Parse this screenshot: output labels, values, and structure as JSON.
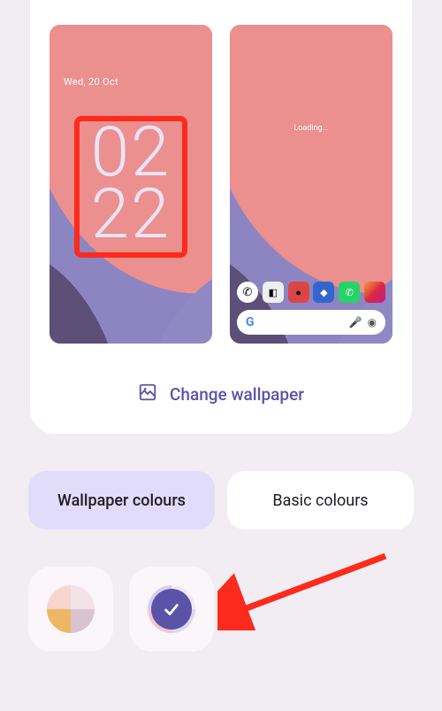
{
  "lockscreen": {
    "date": "Wed, 20 Oct",
    "clock_top": "02",
    "clock_bottom": "22"
  },
  "homescreen": {
    "loading": "Loading...",
    "search_letter": "G"
  },
  "change_wallpaper_label": "Change wallpaper",
  "tabs": {
    "wallpaper": "Wallpaper colours",
    "basic": "Basic colours"
  },
  "palettes": [
    {
      "q": [
        "#f6d6cf",
        "#f3e2e5",
        "#edb864",
        "#d9c3d1"
      ],
      "selected": false
    },
    {
      "q": [
        "#d6d1ef",
        "#f0e9f4",
        "#f2c6d1",
        "#ded7f0"
      ],
      "selected": true
    }
  ],
  "colors": {
    "accent": "#5a53a7",
    "annotation": "#fc2b1c"
  }
}
